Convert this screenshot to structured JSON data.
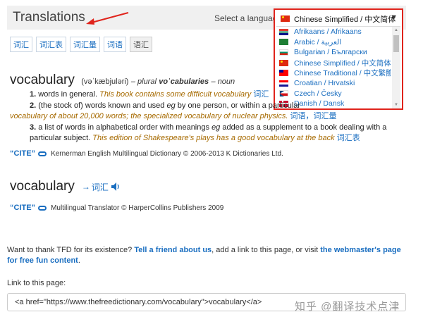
{
  "header": {
    "title": "Translations",
    "language_label": "Select a language:"
  },
  "language_select": {
    "selected": "Chinese Simplified / 中文简体",
    "selected_flag": "cn-flag-icon",
    "options": [
      {
        "label": "Afrikaans / Afrikaans",
        "flag": "za-flag-icon"
      },
      {
        "label": "Arabic / العربية",
        "flag": "ar-flag-icon"
      },
      {
        "label": "Bulgarian / Български",
        "flag": "bg-flag-icon"
      },
      {
        "label": "Chinese Simplified / 中文简体",
        "flag": "cn-flag-icon"
      },
      {
        "label": "Chinese Traditional / 中文繁體",
        "flag": "tw-flag-icon"
      },
      {
        "label": "Croatian / Hrvatski",
        "flag": "hr-flag-icon"
      },
      {
        "label": "Czech / Česky",
        "flag": "cz-flag-icon"
      },
      {
        "label": "Danish / Dansk",
        "flag": "dk-flag-icon"
      }
    ],
    "highlight_color": "#e0241c"
  },
  "tabs": [
    {
      "label": "词汇"
    },
    {
      "label": "词汇表"
    },
    {
      "label": "词汇量"
    },
    {
      "label": "词语"
    },
    {
      "label": "语汇"
    }
  ],
  "entry1": {
    "headword": "vocabulary",
    "pronunciation": "(vəˈkæbjuləri)",
    "plural_prefix": "– plural",
    "plural_form": "voˈcabularies",
    "pos": "– noun",
    "sense1": {
      "num": "1.",
      "text": "words in general.",
      "example": "This book contains some difficult vocabulary",
      "zh": "词汇"
    },
    "sense2": {
      "num": "2.",
      "text": "(the stock of) words known and used",
      "eg": "eg",
      "text2": "by one person, or within a particular",
      "example": "vocabulary of about 20,000 words; the specialized vocabulary of nuclear physics.",
      "zh": "词语，词汇量"
    },
    "sense3": {
      "num": "3.",
      "text": "a list of words in alphabetical order with meanings",
      "eg": "eg",
      "text2": "added as a supplement to a book dealing with a particular subject.",
      "example": "This edition of Shakespeare's plays has a good vocabulary at the back",
      "zh": "词汇表"
    },
    "cite_label": "“CITE”",
    "source": "Kernerman English Multilingual Dictionary © 2006-2013 K Dictionaries Ltd."
  },
  "entry2": {
    "headword": "vocabulary",
    "arrow": "→",
    "translation": "词汇",
    "cite_label": "“CITE”",
    "source": "Multilingual Translator © HarperCollins Publishers 2009"
  },
  "footer": {
    "thanks_prefix": "Want to thank TFD for its existence?",
    "tell_friend": "Tell a friend about us",
    "thanks_middle": ", add a link to this page, or visit",
    "webmaster": "the webmaster's page for free fun content",
    "thanks_end": ".",
    "link_label": "Link to this page:",
    "link_code": "<a href=\"https://www.thefreedictionary.com/vocabulary\">vocabulary</a>"
  },
  "watermark": "知乎 @翻译技术点津"
}
